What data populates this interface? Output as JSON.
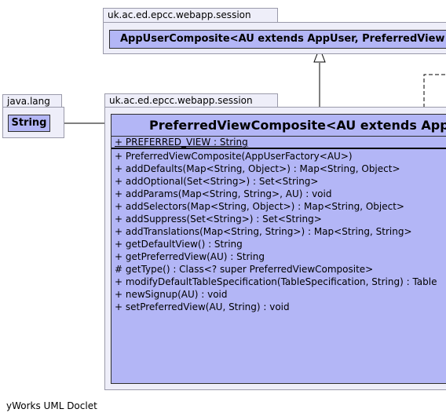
{
  "packages": {
    "top": "uk.ac.ed.epcc.webapp.session",
    "left": "java.lang",
    "middle": "uk.ac.ed.epcc.webapp.session"
  },
  "classes": {
    "app_user_composite": "AppUserComposite<AU extends AppUser, PreferredView",
    "string": "String",
    "preferred_view_composite": "PreferredViewComposite<AU extends App"
  },
  "attributes": [
    "+  PREFERRED_VIEW : String"
  ],
  "methods": [
    "+ PreferredViewComposite(AppUserFactory<AU>)",
    "+ addDefaults(Map<String, Object>) : Map<String, Object>",
    "+ addOptional(Set<String>) : Set<String>",
    "+ addParams(Map<String, String>, AU) : void",
    "+ addSelectors(Map<String, Object>) : Map<String, Object>",
    "+ addSuppress(Set<String>) : Set<String>",
    "+ addTranslations(Map<String, String>) : Map<String, String>",
    "+ getDefaultView() : String",
    "+ getPreferredView(AU) : String",
    "# getType() : Class<? super PreferredViewComposite>",
    "+ modifyDefaultTableSpecification(TableSpecification, String) : Table",
    "+ newSignup(AU) : void",
    "+ setPreferredView(AU, String) : void"
  ],
  "footer": "yWorks UML Doclet"
}
